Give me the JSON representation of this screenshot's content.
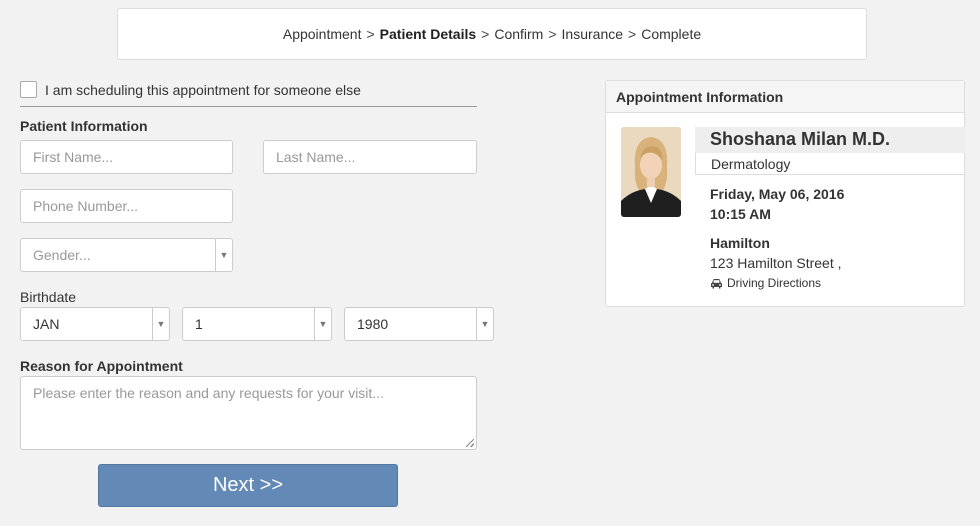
{
  "breadcrumb": {
    "steps": [
      "Appointment",
      "Patient Details",
      "Confirm",
      "Insurance",
      "Complete"
    ],
    "separator": ">",
    "active_index": 1
  },
  "form": {
    "someone_else_label": "I am scheduling this appointment for someone else",
    "someone_else_checked": false,
    "patient_info_title": "Patient Information",
    "first_name_placeholder": "First Name...",
    "last_name_placeholder": "Last Name...",
    "phone_placeholder": "Phone Number...",
    "gender_placeholder": "Gender...",
    "birthdate_label": "Birthdate",
    "birth_month": "JAN",
    "birth_day": "1",
    "birth_year": "1980",
    "reason_title": "Reason for Appointment",
    "reason_placeholder": "Please enter the reason and any requests for your visit...",
    "next_label": "Next >>"
  },
  "appointment": {
    "header": "Appointment Information",
    "doctor_name": "Shoshana Milan M.D.",
    "specialty": "Dermatology",
    "date": "Friday, May 06, 2016",
    "time": "10:15 AM",
    "location_name": "Hamilton",
    "address": "123 Hamilton Street ,",
    "directions_label": "Driving Directions"
  },
  "colors": {
    "accent": "#6389b7",
    "background": "#f2f2f2"
  }
}
